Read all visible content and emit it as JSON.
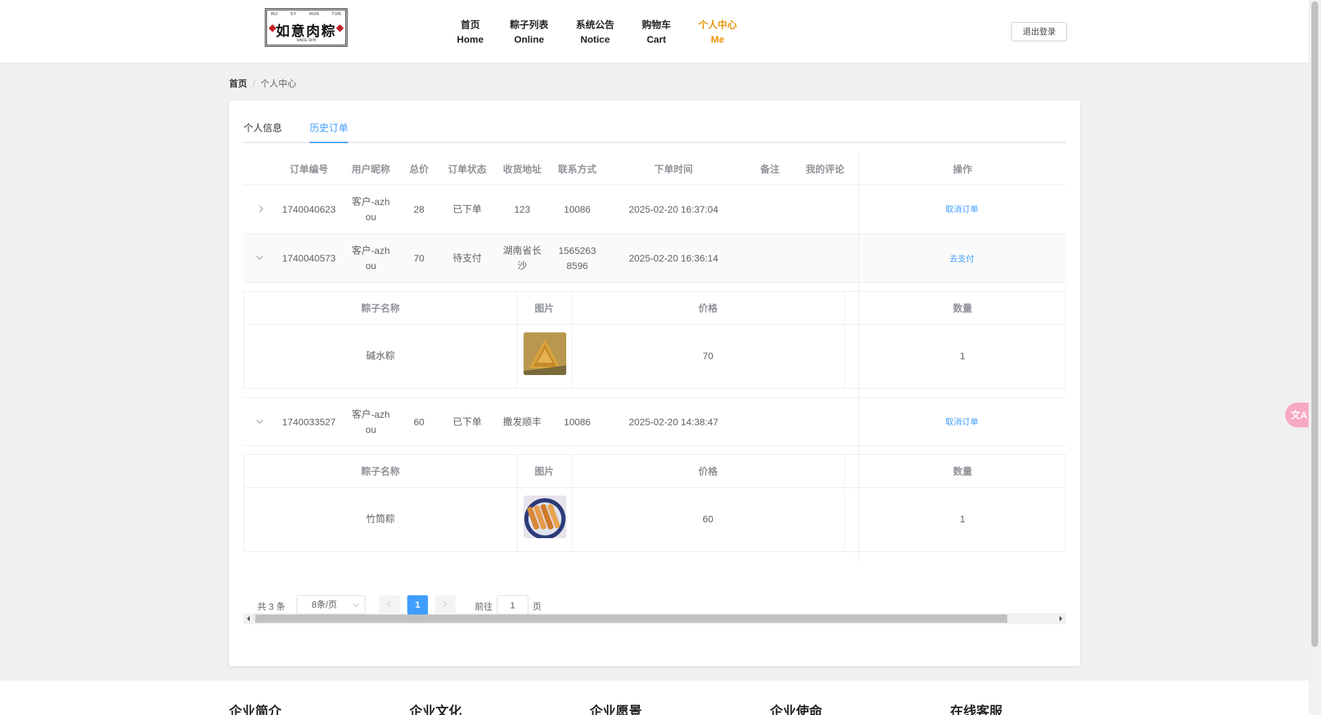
{
  "logo": {
    "top_text": [
      "RU",
      "SY",
      "HUN",
      "TUN"
    ],
    "name": "如意肉粽",
    "since": "SINCE 1978"
  },
  "nav": [
    {
      "cn": "首页",
      "en": "Home"
    },
    {
      "cn": "粽子列表",
      "en": "Online"
    },
    {
      "cn": "系统公告",
      "en": "Notice"
    },
    {
      "cn": "购物车",
      "en": "Cart"
    },
    {
      "cn": "个人中心",
      "en": "Me"
    }
  ],
  "header": {
    "logout": "退出登录"
  },
  "breadcrumb": {
    "home": "首页",
    "sep": "/",
    "current": "个人中心"
  },
  "tabs": [
    "个人信息",
    "历史订单"
  ],
  "table": {
    "columns": [
      "订单编号",
      "用户昵称",
      "总价",
      "订单状态",
      "收货地址",
      "联系方式",
      "下单时间",
      "备注",
      "我的评论",
      "操作"
    ],
    "rows": [
      {
        "id": "1740040623",
        "user": "客户-azh ou",
        "total": "28",
        "status": "已下单",
        "address": "123",
        "phone": "10086",
        "time": "2025-02-20 16:37:04",
        "remark": "",
        "comment": "",
        "action": "取消订单",
        "expanded": false
      },
      {
        "id": "1740040573",
        "user": "客户-azh ou",
        "total": "70",
        "status": "待支付",
        "address": "湖南省长沙",
        "phone": "1565263 8596",
        "time": "2025-02-20 16:36:14",
        "remark": "",
        "comment": "",
        "action": "去支付",
        "expanded": true
      },
      {
        "id": "1740033527",
        "user": "客户-azh ou",
        "total": "60",
        "status": "已下单",
        "address": "撒发顺丰",
        "phone": "10086",
        "time": "2025-02-20 14:38:47",
        "remark": "",
        "comment": "",
        "action": "取消订单",
        "expanded": true
      }
    ],
    "sub_columns": [
      "粽子名称",
      "图片",
      "价格",
      "数量"
    ],
    "sub_items": [
      {
        "name": "碱水粽",
        "price": "70",
        "qty": "1"
      },
      {
        "name": "竹筒粽",
        "price": "60",
        "qty": "1"
      }
    ]
  },
  "pagination": {
    "total": "共 3 条",
    "size": "8条/页",
    "page": "1",
    "goto": "前往",
    "goto_value": "1",
    "page_unit": "页"
  },
  "footer": [
    "企业简介",
    "企业文化",
    "企业愿景",
    "企业使命",
    "在线客服"
  ],
  "translate_widget": "文A",
  "colors": {
    "accent": "#409eff",
    "nav_active": "#e8940c"
  }
}
